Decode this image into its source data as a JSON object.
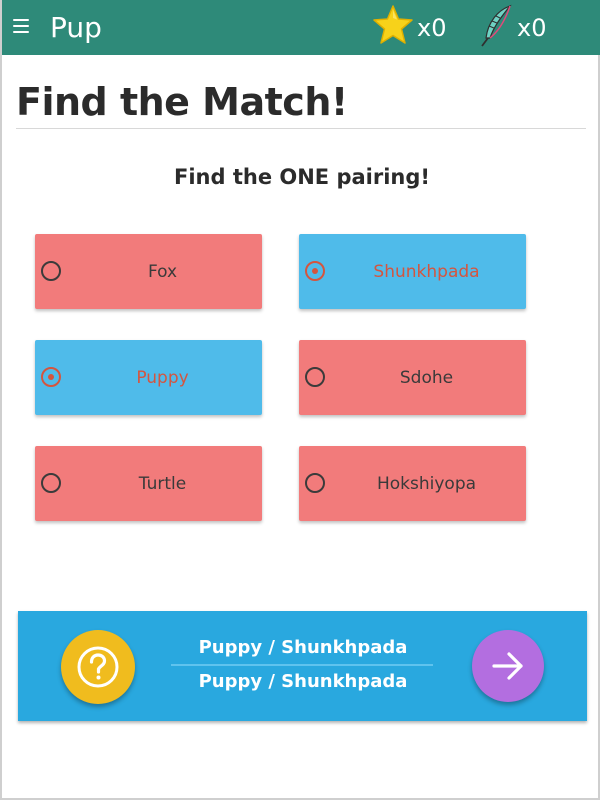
{
  "header": {
    "app_title": "Pup",
    "star_count": "x0",
    "feather_count": "x0",
    "bar_color": "#2e8a79"
  },
  "main": {
    "title": "Find the Match!",
    "instruction": "Find the ONE pairing!"
  },
  "options": [
    {
      "label": "Fox",
      "color": "red",
      "selected": false
    },
    {
      "label": "Shunkhpada",
      "color": "blue",
      "selected": true
    },
    {
      "label": "Puppy",
      "color": "blue",
      "selected": true
    },
    {
      "label": "Sdohe",
      "color": "red",
      "selected": false
    },
    {
      "label": "Turtle",
      "color": "red",
      "selected": false
    },
    {
      "label": "Hokshiyopa",
      "color": "red",
      "selected": false
    }
  ],
  "footer": {
    "answer_line_1": "Puppy / Shunkhpada",
    "answer_line_2": "Puppy / Shunkhpada",
    "help_icon": "question-mark-icon",
    "next_icon": "arrow-right-icon"
  },
  "colors": {
    "red_option": "#f27b7b",
    "blue_option": "#4fbbea",
    "selected_accent": "#d4553f",
    "footer_bg": "#29a8df",
    "help_button": "#f0bc1e",
    "next_button": "#b36ee0"
  }
}
